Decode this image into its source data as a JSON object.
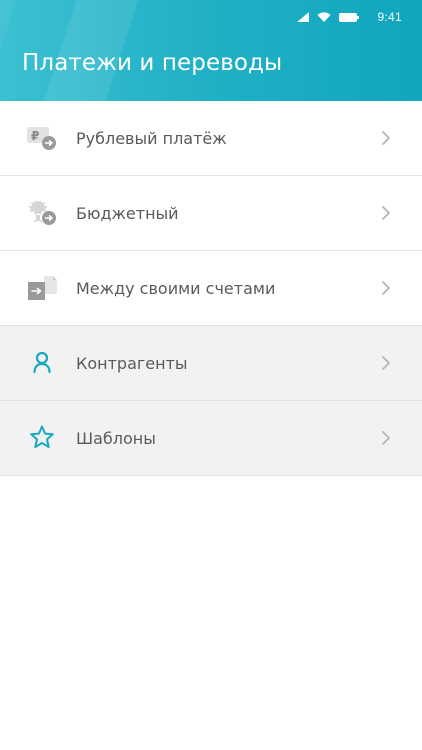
{
  "status_bar": {
    "time": "9:41",
    "icons": [
      "signal-icon",
      "wifi-icon",
      "battery-icon"
    ]
  },
  "header": {
    "title": "Платежи и переводы",
    "gradient_start": "#3cc0d2",
    "gradient_end": "#0fa6be"
  },
  "menu": {
    "items": [
      {
        "label": "Рублевый платёж",
        "icon": "ruble-transfer-icon"
      },
      {
        "label": "Бюджетный",
        "icon": "budget-eagle-icon"
      },
      {
        "label": "Между своими счетами",
        "icon": "own-accounts-icon"
      },
      {
        "label": "Контрагенты",
        "icon": "person-icon"
      },
      {
        "label": "Шаблоны",
        "icon": "star-icon"
      }
    ]
  },
  "colors": {
    "accent": "#17a9bf",
    "text": "#5a5a5a",
    "divider": "#e2e2e2",
    "alt_row": "#f2f2f2",
    "chevron": "#b5b5b5"
  }
}
